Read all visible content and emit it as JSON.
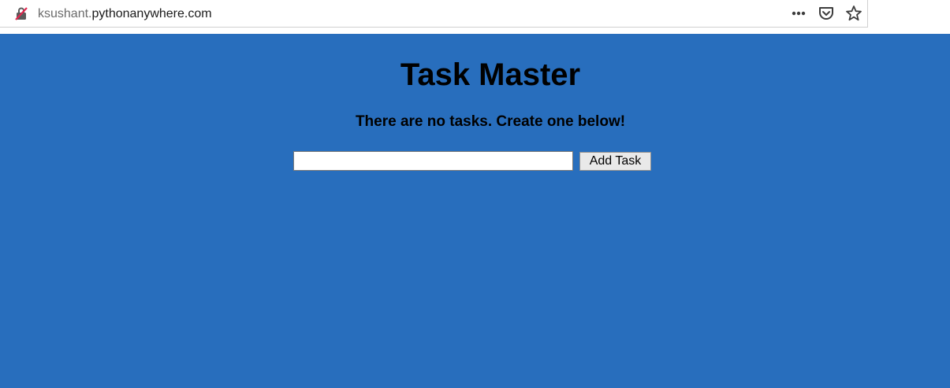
{
  "browser": {
    "url_subdomain": "ksushant.",
    "url_host": "pythonanywhere.com",
    "icons": [
      "insecure-lock-icon",
      "more-actions-icon",
      "pocket-icon",
      "bookmark-star-icon"
    ]
  },
  "page": {
    "title": "Task Master",
    "message": "There are no tasks. Create one below!",
    "task_input_value": "",
    "add_button_label": "Add Task",
    "background_color": "#286ebd"
  }
}
